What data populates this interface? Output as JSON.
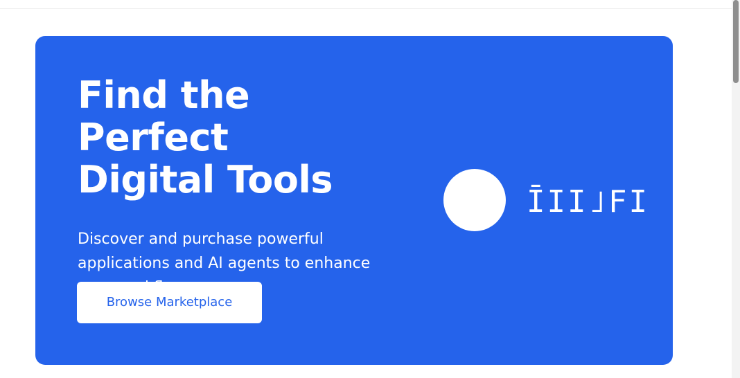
{
  "hero": {
    "title": "Find the Perfect\nDigital Tools",
    "subtitle": "Discover and purchase powerful applications and AI agents to enhance your workflow",
    "cta_label": "Browse Marketplace",
    "brand_wordmark": "ĪII˩FI"
  },
  "colors": {
    "accent": "#2563eb",
    "surface": "#ffffff",
    "scrollbar_thumb": "#8e8e8e",
    "scrollbar_track": "#f3f3f3"
  }
}
